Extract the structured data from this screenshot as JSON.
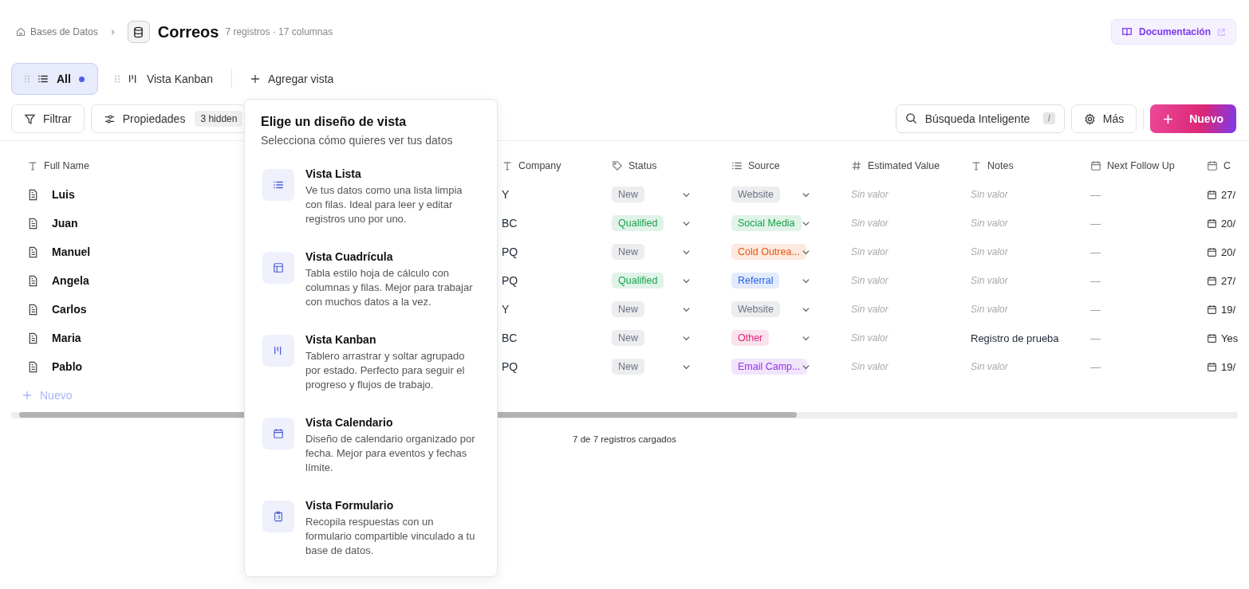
{
  "breadcrumb": {
    "parent": "Bases de Datos",
    "title": "Correos",
    "meta": "7 registros · 17 columnas"
  },
  "docs_button": "Documentación",
  "views": [
    {
      "label": "All",
      "kind": "list",
      "selected": true,
      "dot": true
    },
    {
      "label": "Vista Kanban",
      "kind": "kanban",
      "selected": false,
      "dot": false
    }
  ],
  "add_view": "Agregar vista",
  "toolbar": {
    "filter": "Filtrar",
    "properties": "Propiedades",
    "hidden_badge": "3 hidden",
    "search_placeholder": "Búsqueda Inteligente",
    "shortcut": "/",
    "more": "Más",
    "new": "Nuevo"
  },
  "table": {
    "columns": [
      {
        "label": "Full Name",
        "kind": "text"
      },
      {
        "label": "Company",
        "kind": "text"
      },
      {
        "label": "Status",
        "kind": "tag"
      },
      {
        "label": "Source",
        "kind": "list"
      },
      {
        "label": "Estimated Value",
        "kind": "number"
      },
      {
        "label": "Notes",
        "kind": "text"
      },
      {
        "label": "Next Follow Up",
        "kind": "date"
      },
      {
        "label": "C",
        "kind": "date"
      }
    ],
    "rows": [
      {
        "full_name": "Luis",
        "company": "Y",
        "status": {
          "label": "New",
          "color": "#6b7280"
        },
        "source": {
          "label": "Website",
          "color": "#6b7280"
        },
        "estimated_value": {
          "text": "Sin valor",
          "empty": true
        },
        "notes": {
          "text": "Sin valor",
          "empty": true
        },
        "next_follow_up": "—",
        "column_8": "27/"
      },
      {
        "full_name": "Juan",
        "company": "BC",
        "status": {
          "label": "Qualified",
          "color": "#16a34a"
        },
        "source": {
          "label": "Social Media",
          "color": "#16a34a"
        },
        "estimated_value": {
          "text": "Sin valor",
          "empty": true
        },
        "notes": {
          "text": "Sin valor",
          "empty": true
        },
        "next_follow_up": "—",
        "column_8": "20/"
      },
      {
        "full_name": "Manuel",
        "company": "PQ",
        "status": {
          "label": "New",
          "color": "#6b7280"
        },
        "source": {
          "label": "Cold Outrea...",
          "color": "#ea580c"
        },
        "estimated_value": {
          "text": "Sin valor",
          "empty": true
        },
        "notes": {
          "text": "Sin valor",
          "empty": true
        },
        "next_follow_up": "—",
        "column_8": "20/"
      },
      {
        "full_name": "Angela",
        "company": "PQ",
        "status": {
          "label": "Qualified",
          "color": "#16a34a"
        },
        "source": {
          "label": "Referral",
          "color": "#2563eb"
        },
        "estimated_value": {
          "text": "Sin valor",
          "empty": true
        },
        "notes": {
          "text": "Sin valor",
          "empty": true
        },
        "next_follow_up": "—",
        "column_8": "27/"
      },
      {
        "full_name": "Carlos",
        "company": "Y",
        "status": {
          "label": "New",
          "color": "#6b7280"
        },
        "source": {
          "label": "Website",
          "color": "#6b7280"
        },
        "estimated_value": {
          "text": "Sin valor",
          "empty": true
        },
        "notes": {
          "text": "Sin valor",
          "empty": true
        },
        "next_follow_up": "—",
        "column_8": "19/"
      },
      {
        "full_name": "Maria",
        "company": "BC",
        "status": {
          "label": "New",
          "color": "#6b7280"
        },
        "source": {
          "label": "Other",
          "color": "#db2777"
        },
        "estimated_value": {
          "text": "Sin valor",
          "empty": true
        },
        "notes": {
          "text": "Registro de prueba",
          "empty": false
        },
        "next_follow_up": "—",
        "column_8": "Yes"
      },
      {
        "full_name": "Pablo",
        "company": "PQ",
        "status": {
          "label": "New",
          "color": "#6b7280"
        },
        "source": {
          "label": "Email Camp...",
          "color": "#9333ea"
        },
        "estimated_value": {
          "text": "Sin valor",
          "empty": true
        },
        "notes": {
          "text": "Sin valor",
          "empty": true
        },
        "next_follow_up": "—",
        "column_8": "19/"
      }
    ],
    "add_row": "Nuevo"
  },
  "footer": "7 de 7 registros cargados",
  "popover": {
    "title": "Elige un diseño de vista",
    "subtitle": "Selecciona cómo quieres ver tus datos",
    "options": [
      {
        "kind": "list",
        "title": "Vista Lista",
        "description": "Ve tus datos como una lista limpia con filas. Ideal para leer y editar registros uno por uno."
      },
      {
        "kind": "grid",
        "title": "Vista Cuadrícula",
        "description": "Tabla estilo hoja de cálculo con columnas y filas. Mejor para trabajar con muchos datos a la vez."
      },
      {
        "kind": "kanban",
        "title": "Vista Kanban",
        "description": "Tablero arrastrar y soltar agrupado por estado. Perfecto para seguir el progreso y flujos de trabajo."
      },
      {
        "kind": "calendar",
        "title": "Vista Calendario",
        "description": "Diseño de calendario organizado por fecha. Mejor para eventos y fechas límite."
      },
      {
        "kind": "form",
        "title": "Vista Formulario",
        "description": "Recopila respuestas con un formulario compartible vinculado a tu base de datos."
      }
    ]
  }
}
